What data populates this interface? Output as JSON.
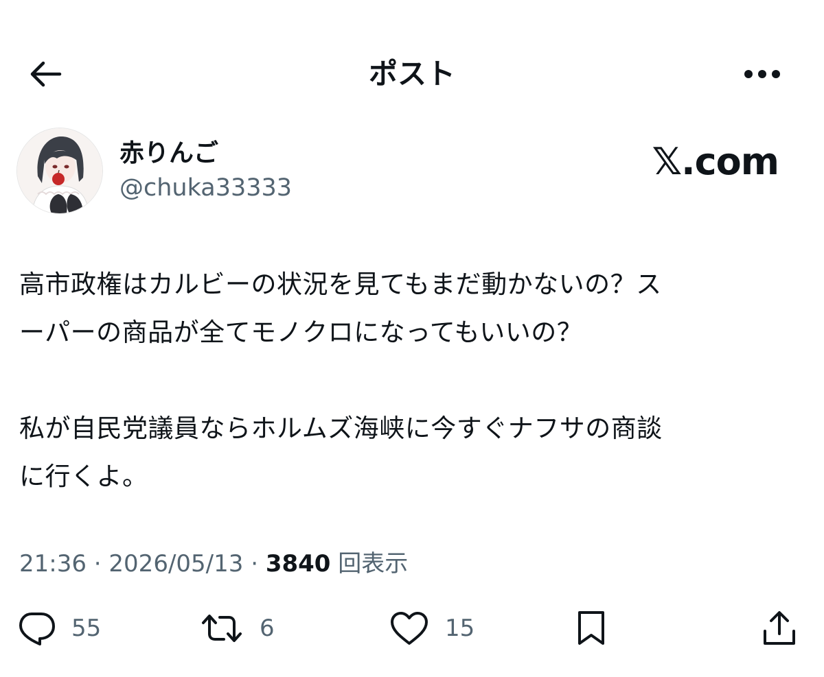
{
  "header": {
    "title": "ポスト"
  },
  "author": {
    "display_name": "赤りんご",
    "handle": "@chuka33333"
  },
  "watermark": "𝕏.com",
  "post": {
    "text_lines": [
      "高市政権はカルビーの状況を見てもまだ動かないの？ス\nーパーの商品が全てモノクロになってもいいの？",
      "私が自民党議員ならホルムズ海峡に今すぐナフサの商談\nに行くよ。"
    ]
  },
  "meta": {
    "time": "21:36",
    "separator": " · ",
    "date": "2026/05/13",
    "views_count": "3840",
    "views_label": " 回表示"
  },
  "actions": {
    "reply_count": "55",
    "repost_count": "6",
    "like_count": "15"
  },
  "colors": {
    "text_primary": "#0f1419",
    "text_secondary": "#536471",
    "background": "#ffffff"
  },
  "icons": {
    "back": "arrow-left-icon",
    "more": "more-horizontal-icon",
    "reply": "speech-bubble-icon",
    "repost": "repost-arrows-icon",
    "like": "heart-icon",
    "bookmark": "bookmark-icon",
    "share": "share-upload-icon"
  }
}
